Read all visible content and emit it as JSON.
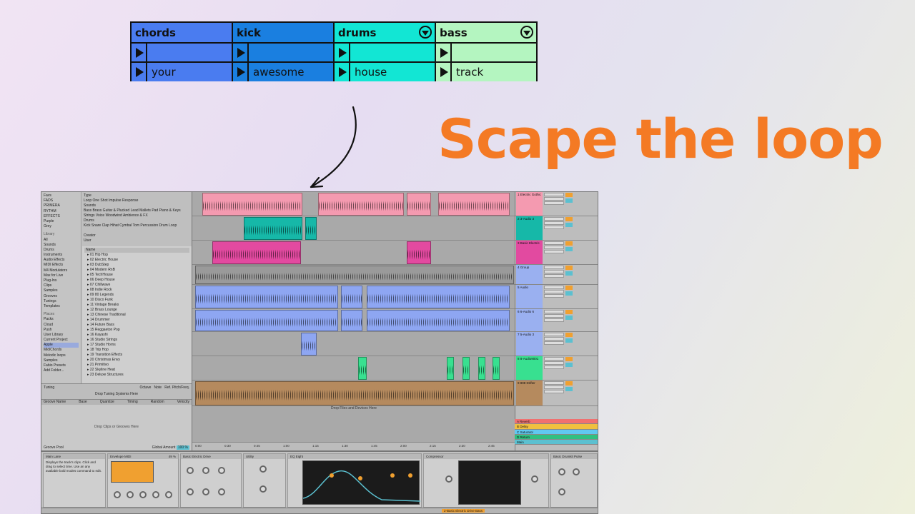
{
  "session_grid": {
    "tracks": [
      {
        "name": "chords",
        "color": "#4a7cf0",
        "clips": [
          "",
          "your"
        ]
      },
      {
        "name": "kick",
        "color": "#1a7fe0",
        "clips": [
          "",
          "awesome"
        ]
      },
      {
        "name": "drums",
        "color": "#12e6d4",
        "clips": [
          "",
          "house"
        ],
        "fold": true
      },
      {
        "name": "bass",
        "color": "#b4f5c0",
        "clips": [
          "",
          "track"
        ],
        "fold": true
      }
    ]
  },
  "headline": "Scape the loop",
  "live": {
    "places": {
      "collections": [
        "Favs",
        "FADS",
        "PRIMERA",
        "RYTHM",
        "EFFECTS",
        "Purple",
        "Grey"
      ],
      "library_header": "Library",
      "library": [
        "All",
        "Sounds",
        "Drums",
        "Instruments",
        "Audio Effects",
        "MIDI Effects",
        "M4 Modulators",
        "Max for Live",
        "Plug-Ins",
        "Clips",
        "Samples",
        "Grooves",
        "Tunings",
        "Templates"
      ],
      "places_header": "Places",
      "places": [
        "Packs",
        "Cloud",
        "Push",
        "User Library",
        "Current Project",
        "Apple",
        "MidiChords",
        "Melodic loops",
        "Samples",
        "Fabio Presets",
        "Add Folder..."
      ]
    },
    "filters": {
      "type_label": "Type",
      "type_values": "Loop   One Shot   Impulse Response",
      "sounds_label": "Sounds",
      "sounds_values": "Bass   Brass   Guitar & Plucked   Lead   Mallets   Pad   Piano & Keys   Strings   Voice   Woodwind   Ambience & FX",
      "drums_label": "Drums",
      "drums_values": "Kick   Snare   Clap   Hihat   Cymbal   Tom   Percussion   Drum Loop",
      "creator_label": "Creator",
      "creator_value": "User"
    },
    "filelist": {
      "header": "Name",
      "items": [
        "01 Hip Hop",
        "02 Electric House",
        "03 DubStep",
        "04 Modern RnB",
        "05 TechHouse",
        "06 Deep House",
        "07 Chillwave",
        "08 Indie Rock",
        "09 80 Legends",
        "10 Disco Funk",
        "11 Vintage Breaks",
        "12 Brass Lounge",
        "13 Chinese Traditional",
        "14 Drummer",
        "14 Future Bass",
        "15 Reggaeton Pop",
        "16 Kayashi",
        "16 Studio Strings",
        "17 Studio Horns",
        "18 Trip Hop",
        "19 Transition Effects",
        "20 Christmas Envy",
        "21 Primitivo",
        "22 Skyline Heat",
        "23 Deluxe Structures"
      ]
    },
    "tuning": {
      "title": "Tuning",
      "columns": [
        "Octave",
        "Note",
        "Ref. Pitch/Freq."
      ],
      "drop": "Drop Tuning Systems Here"
    },
    "groove": {
      "columns": [
        "Groove Name",
        "Base",
        "Quantize",
        "Timing",
        "Random",
        "Velocity"
      ],
      "drop": "Drop Clips or Grooves Here",
      "footer": "Groove Pool",
      "global_amount_label": "Global Amount",
      "global_amount": "100 %"
    },
    "arrange": {
      "drop_hint": "Drop Files and Devices Here",
      "ruler": [
        "0:00",
        "0:30",
        "0:45",
        "1:00",
        "1:15",
        "1:30",
        "1:45",
        "2:00",
        "2:15",
        "2:30",
        "2:45"
      ]
    },
    "mixer": {
      "tracks": [
        {
          "name": "1 Electric Gothic",
          "color": "#f49ab0"
        },
        {
          "name": "2 3-Audio 3",
          "color": "#16b8a8"
        },
        {
          "name": "3 Basic Electric",
          "color": "#e24aa0"
        },
        {
          "name": "4 Group",
          "color": "#9ab0f0"
        },
        {
          "name": "5 Audio",
          "color": "#9ab0f0"
        },
        {
          "name": "6 6-Audio 6",
          "color": "#9ab0f0"
        },
        {
          "name": "7 5-Audio 3",
          "color": "#9ab0f0"
        },
        {
          "name": "8 8-Audio9001",
          "color": "#38e090"
        },
        {
          "name": "9 808 Drifter",
          "color": "#b58a5e"
        }
      ],
      "returns": [
        {
          "name": "A Reverb",
          "color": "#f07070"
        },
        {
          "name": "B Delay",
          "color": "#f0c040"
        },
        {
          "name": "C Saturator",
          "color": "#60c8f0"
        },
        {
          "name": "D Return",
          "color": "#30c080"
        },
        {
          "name": "Main",
          "color": "#5bc0d0"
        }
      ]
    },
    "devices": [
      {
        "name": "Main Lane",
        "text": "Displays the track's clips. Click and drag to select time. Use an any available bold modes command to edit."
      },
      {
        "name": "Envelope MIDI",
        "value": "49 %"
      },
      {
        "name": "Basic Electric Drive"
      },
      {
        "name": "Utility"
      },
      {
        "name": "EQ Eight"
      },
      {
        "name": "Compressor"
      },
      {
        "name": "Basic Drumkit Pulse"
      }
    ],
    "status": "2-Basic Electric Drive Bass"
  }
}
